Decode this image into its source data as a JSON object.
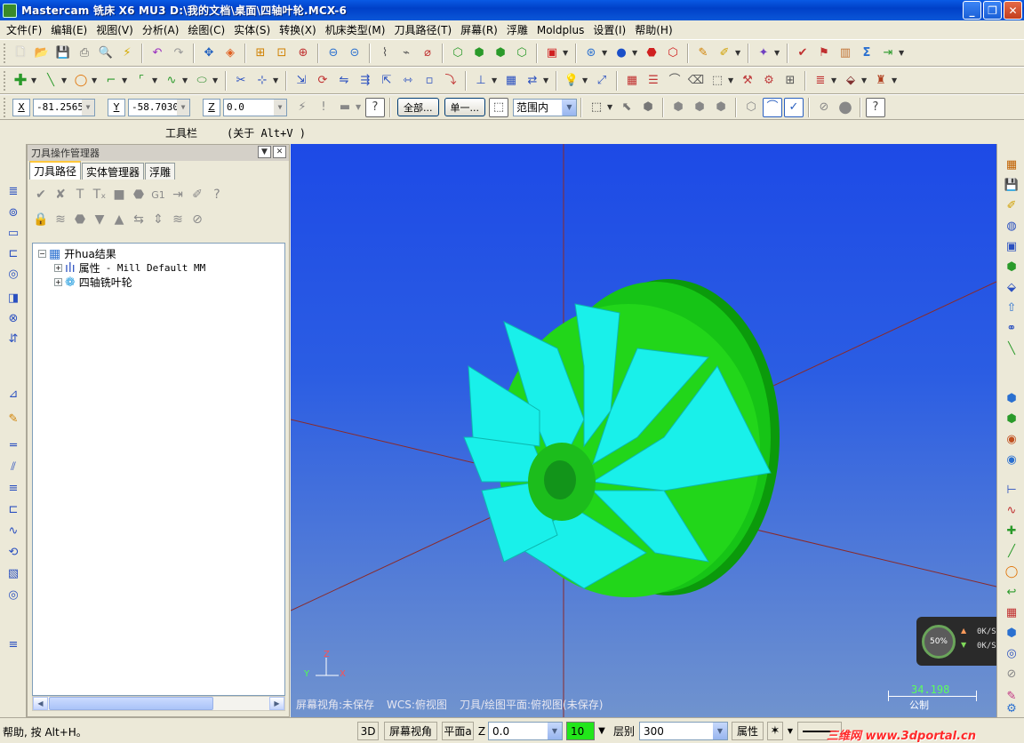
{
  "title": "Mastercam 铣床 X6 MU3  D:\\我的文档\\桌面\\四轴叶轮.MCX-6",
  "window_buttons": [
    "minimize",
    "restore",
    "close"
  ],
  "menu": [
    "文件(F)",
    "编辑(E)",
    "视图(V)",
    "分析(A)",
    "绘图(C)",
    "实体(S)",
    "转换(X)",
    "机床类型(M)",
    "刀具路径(T)",
    "屏幕(R)",
    "浮雕",
    "Moldplus",
    "设置(I)",
    "帮助(H)"
  ],
  "coords": {
    "x_label": "X",
    "x_value": "-81.2565",
    "y_label": "Y",
    "y_value": "-58.7030",
    "z_label": "Z",
    "z_value": "0.0"
  },
  "selection": {
    "all_btn": "全部...",
    "single_btn": "单一...",
    "range_value": "范围内"
  },
  "toolbar_caption": {
    "label": "工具栏",
    "about": "(关于 Alt+V )"
  },
  "panel": {
    "title": "刀具操作管理器",
    "tabs": [
      "刀具路径",
      "实体管理器",
      "浮雕"
    ],
    "tree": {
      "root": "开hua结果",
      "child1_label": "属性",
      "child1_detail": "- Mill Default MM",
      "child2": "四轴铣叶轮"
    }
  },
  "viewport": {
    "status_screen_view": "屏幕视角:未保存",
    "status_wcs": "WCS:俯视图",
    "status_tool_plane": "刀具/绘图平面:俯视图(未保存)",
    "axis_x": "X",
    "axis_y": "Y",
    "axis_z": "Z",
    "scale_value": "34.198",
    "scale_unit": "公制",
    "perf_percent": "50%",
    "perf_up": "0K/S",
    "perf_down": "0K/S",
    "colors": {
      "impeller": "#22d61a",
      "blade": "#19f0ea",
      "background": "#2b5de3"
    }
  },
  "statusbar": {
    "help": "帮助, 按 Alt+H。",
    "btn_3d": "3D",
    "btn_screen_view": "屏幕视角",
    "btn_plane": "平面a",
    "z_label": "Z",
    "z_value": "0.0",
    "color_value": "10",
    "layer_label": "层别",
    "layer_value": "300",
    "attr_label": "属性",
    "watermark": "三维网 www.3dportal.cn"
  }
}
